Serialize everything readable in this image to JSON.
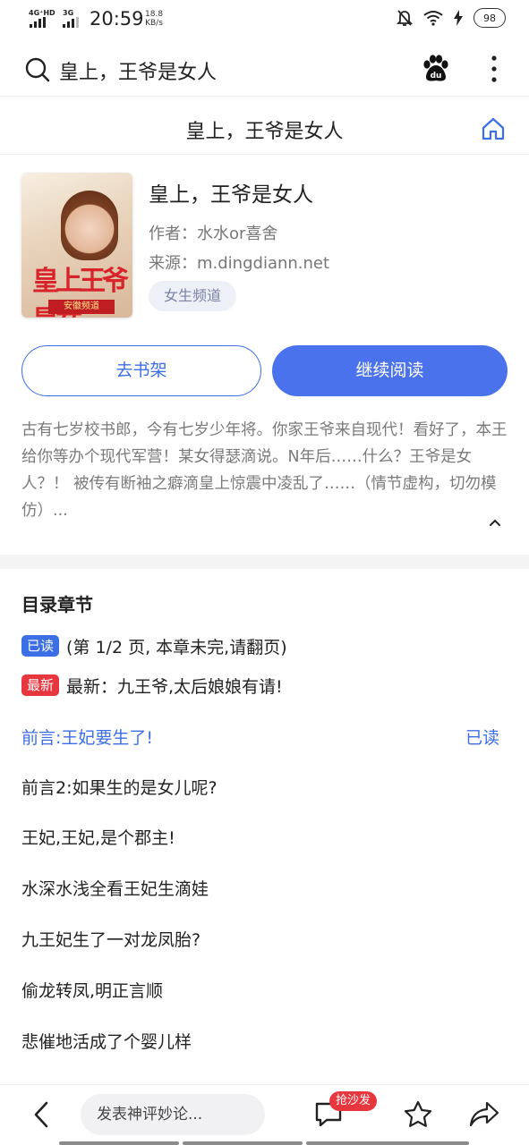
{
  "status_bar": {
    "network1": "4G⁺HD",
    "network2": "3G",
    "time": "20:59",
    "speed_value": "18.8",
    "speed_unit": "KB/s",
    "battery": "98"
  },
  "search": {
    "query": "皇上，王爷是女人"
  },
  "title_bar": {
    "title": "皇上，王爷是女人"
  },
  "book": {
    "title": "皇上，王爷是女人",
    "author": "作者：水水or喜舍",
    "source": "来源：m.dingdiann.net",
    "tag": "女生频道",
    "cover_title": "皇上王爷是女",
    "cover_band": "安徽频道"
  },
  "actions": {
    "shelf_label": "去书架",
    "continue_label": "继续阅读"
  },
  "description": "古有七岁校书郎，今有七岁少年将。你家王爷来自现代！看好了，本王给你等办个现代军营！某女得瑟滴说。N年后……什么？王爷是女人？！ 被传有断袖之癖滴皇上惊震中凌乱了……（情节虚构，切勿模仿）...",
  "toc": {
    "title": "目录章节",
    "read_badge": "已读",
    "read_info": "(第 1/2 页, 本章未完,请翻页)",
    "new_badge": "最新",
    "new_info": "最新：九王爷,太后娘娘有请!",
    "current_status": "已读",
    "chapters": [
      "前言:王妃要生了!",
      "前言2:如果生的是女儿呢?",
      "王妃,王妃,是个郡主!",
      "水深水浅全看王妃生滴娃",
      "九王妃生了一对龙凤胎?",
      "偷龙转凤,明正言顺",
      "悲催地活成了个婴儿样"
    ]
  },
  "bottom_bar": {
    "comment_placeholder": "发表神评妙论...",
    "sofa_badge": "抢沙发"
  },
  "colors": {
    "accent": "#3c6ee6",
    "badge_red": "#e8363f",
    "muted_text": "#7a7a7a"
  }
}
